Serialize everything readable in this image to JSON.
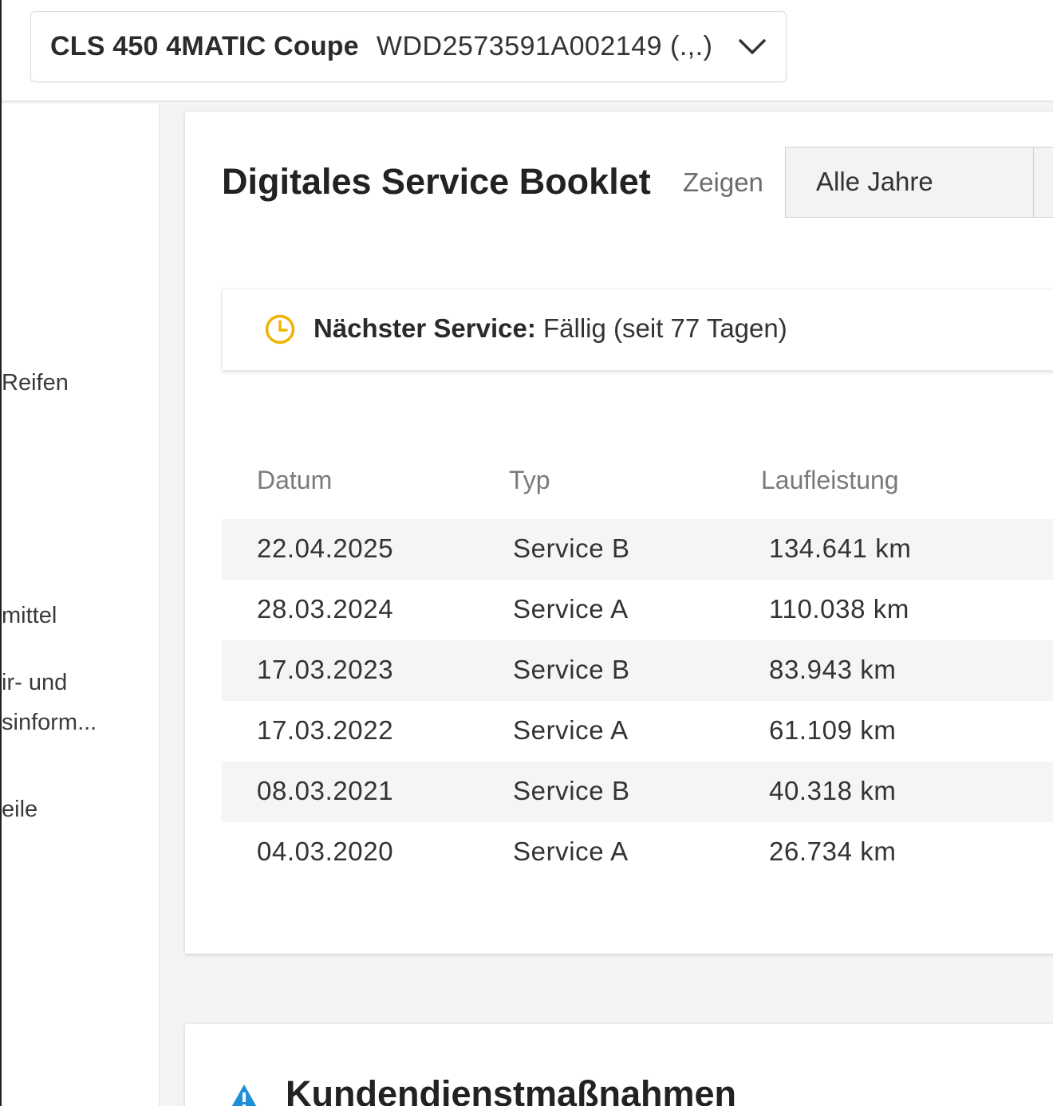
{
  "vehicle": {
    "model": "CLS 450 4MATIC Coupe",
    "vin": "WDD2573591A002149 (.,.)"
  },
  "sidebar": {
    "items": [
      "Reifen",
      "mittel",
      "ir- und",
      "sinform...",
      "eile"
    ]
  },
  "booklet": {
    "title": "Digitales Service Booklet",
    "show_label": "Zeigen",
    "year_filter": "Alle Jahre",
    "next_service": {
      "label": "Nächster Service:",
      "value": "Fällig (seit 77 Tagen)"
    },
    "columns": [
      "Datum",
      "Typ",
      "Laufleistung"
    ],
    "rows": [
      {
        "date": "22.04.2025",
        "type": "Service B",
        "mileage": "134.641 km"
      },
      {
        "date": "28.03.2024",
        "type": "Service A",
        "mileage": "110.038 km"
      },
      {
        "date": "17.03.2023",
        "type": "Service B",
        "mileage": "83.943 km"
      },
      {
        "date": "17.03.2022",
        "type": "Service A",
        "mileage": "61.109 km"
      },
      {
        "date": "08.03.2021",
        "type": "Service B",
        "mileage": "40.318 km"
      },
      {
        "date": "04.03.2020",
        "type": "Service A",
        "mileage": "26.734 km"
      }
    ]
  },
  "recalls": {
    "title": "Kundendienstmaßnahmen"
  },
  "colors": {
    "clock": "#f0b400",
    "warning": "#1f8fd6"
  }
}
